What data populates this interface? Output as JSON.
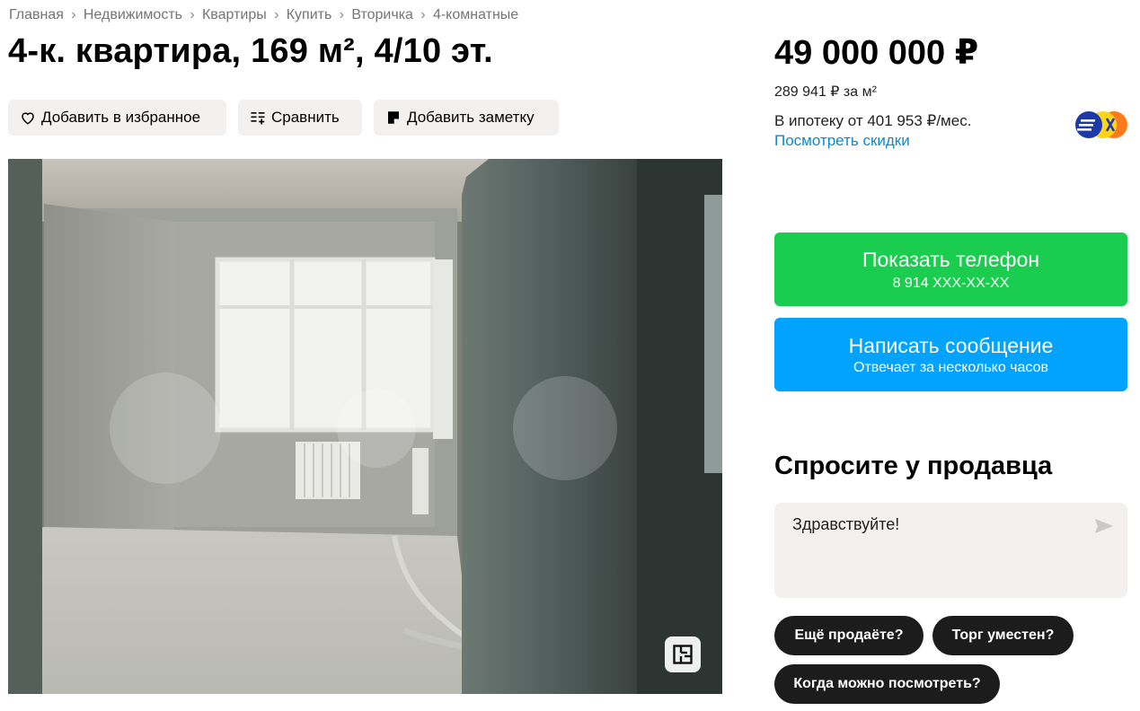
{
  "breadcrumb": [
    "Главная",
    "Недвижимость",
    "Квартиры",
    "Купить",
    "Вторичка",
    "4-комнатные"
  ],
  "title": "4-к. квартира, 169 м², 4/10 эт.",
  "actions": {
    "favorite": "Добавить в избранное",
    "compare": "Сравнить",
    "note": "Добавить заметку"
  },
  "price": {
    "total": "49 000 000 ₽",
    "per_m2": "289 941 ₽ за м²",
    "mortgage": "В ипотеку от 401 953 ₽/мес.",
    "discounts_link": "Посмотреть скидки"
  },
  "contact": {
    "phone_label": "Показать телефон",
    "phone_number": "8 914 XXX-XX-XX",
    "message_label": "Написать сообщение",
    "message_sub": "Отвечает за несколько часов"
  },
  "ask": {
    "title": "Спросите у продавца",
    "message": "Здравствуйте!",
    "quick_replies": [
      "Ещё продаёте?",
      "Торг уместен?",
      "Когда можно посмотреть?"
    ]
  },
  "icons": {
    "favorite": "heart-icon",
    "compare": "compare-icon",
    "note": "note-icon",
    "send": "send-icon",
    "plan": "floor-plan-icon",
    "bank": "bank-logo-icon"
  },
  "colors": {
    "phone_button": "#1bcd4f",
    "message_button": "#02a3ff",
    "link": "#0a8acf",
    "chip": "#1c1c1c"
  }
}
